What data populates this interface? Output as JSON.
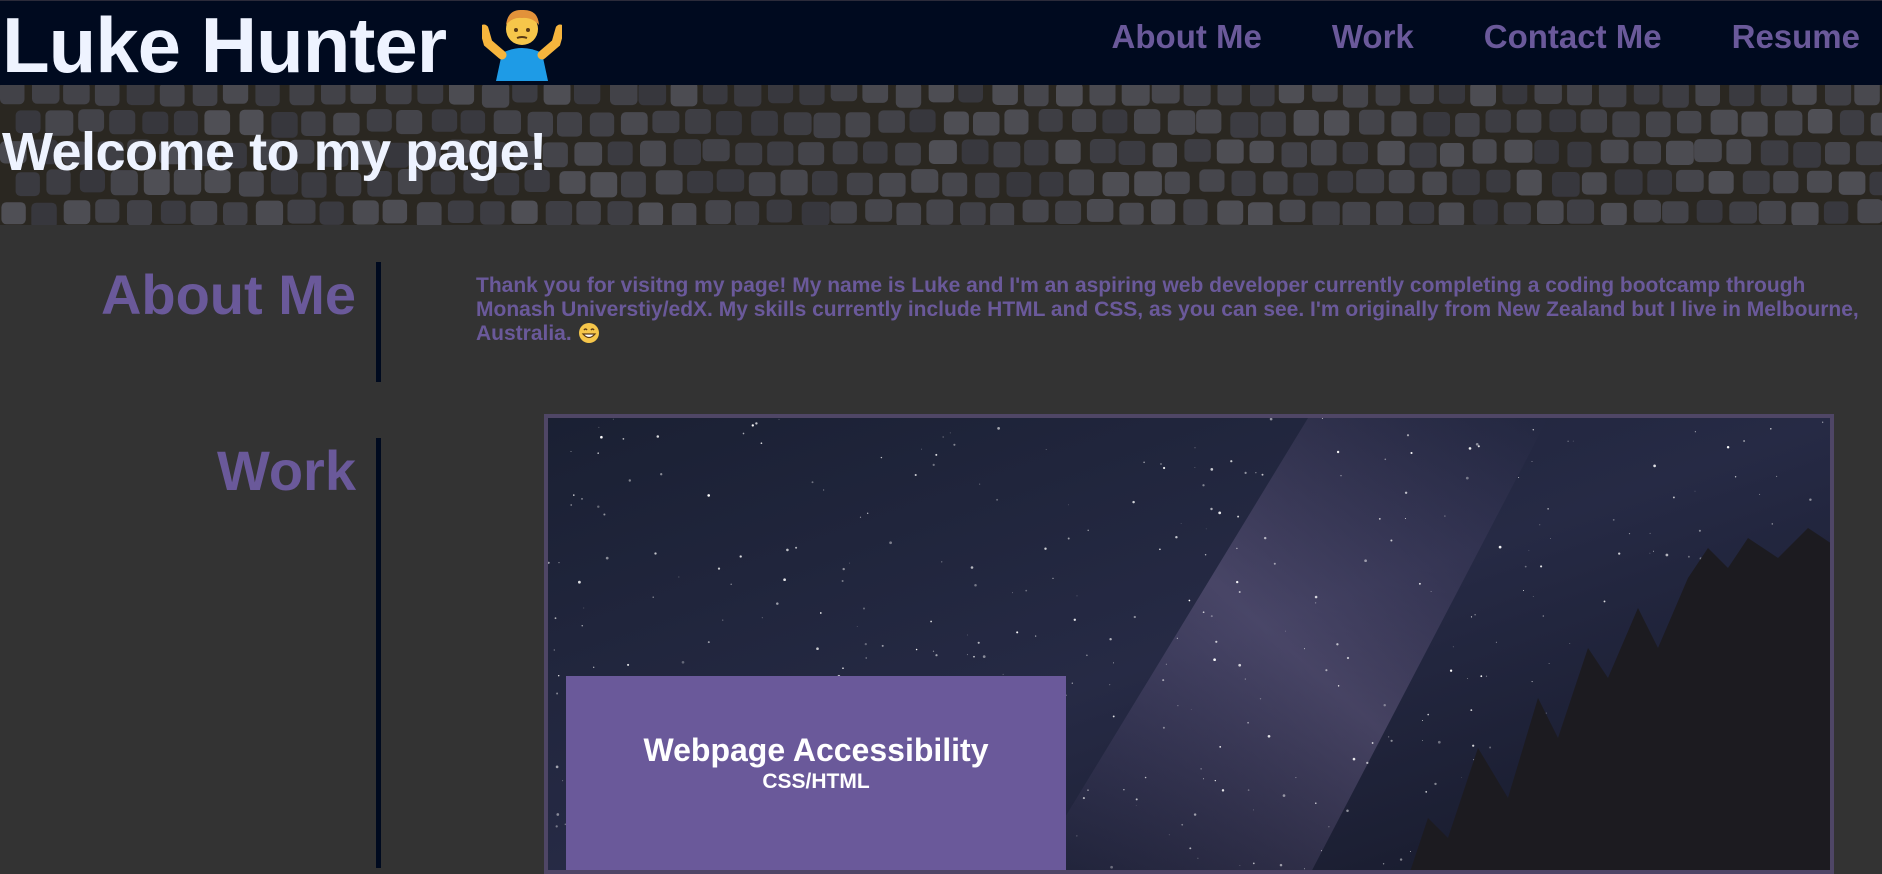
{
  "header": {
    "site_title": "Luke Hunter",
    "title_emoji": "man-shrugging-icon",
    "nav": [
      {
        "label": "About Me"
      },
      {
        "label": "Work"
      },
      {
        "label": "Contact Me"
      },
      {
        "label": "Resume"
      }
    ]
  },
  "hero": {
    "title": "Welcome to my page!"
  },
  "about": {
    "heading": "About Me",
    "text": "Thank you for visitng my page! My name is Luke and I'm an aspiring web developer currently completing a coding bootcamp through Monash Universtiy/edX. My skills currently include HTML and CSS, as you can see. I'm originally from New Zealand but I live in Melbourne, Australia.",
    "text_emoji": "grinning-face-icon"
  },
  "work": {
    "heading": "Work",
    "projects": [
      {
        "title": "Webpage Accessibility",
        "subtitle": "CSS/HTML"
      }
    ]
  },
  "colors": {
    "header_bg": "#000a1f",
    "accent": "#6a599a",
    "page_bg": "#333333",
    "title_text": "#eef3ff"
  }
}
